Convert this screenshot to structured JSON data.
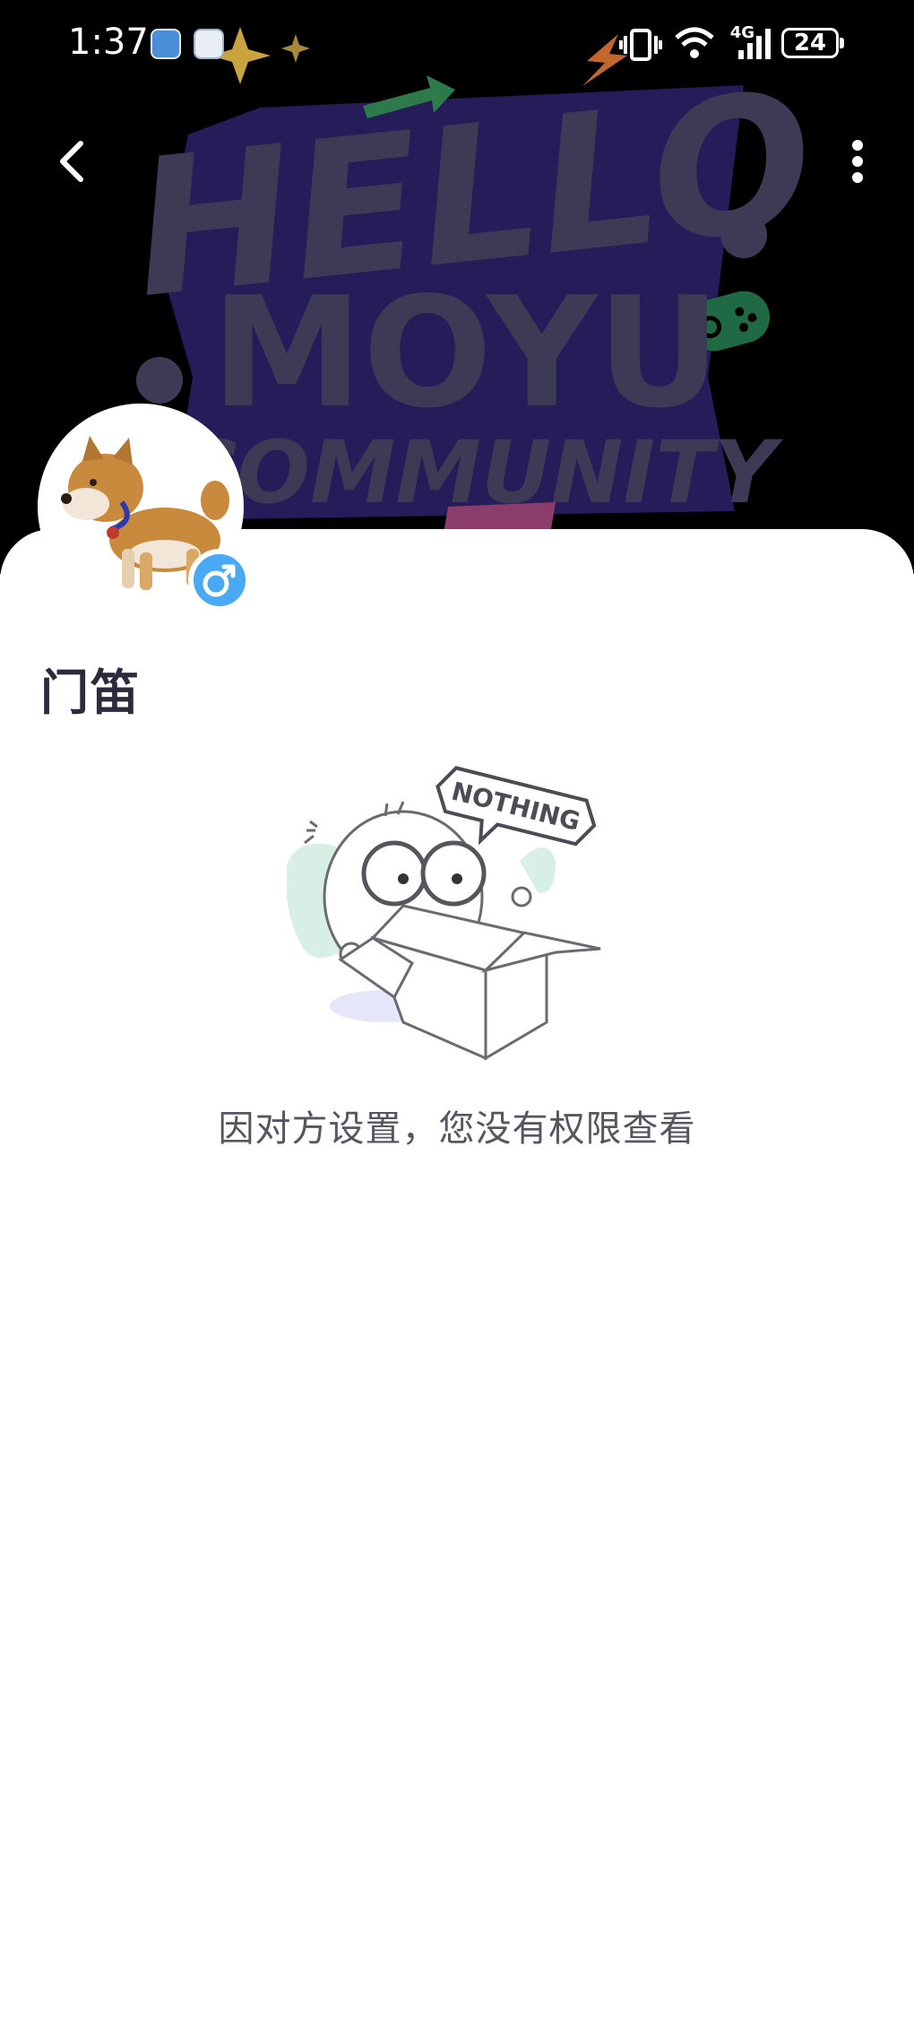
{
  "status_bar": {
    "time": "1:37",
    "battery": "24",
    "network": "4G"
  },
  "banner": {
    "line1": "HELLO",
    "line2": "MOYU",
    "line3": "COMMUNITY"
  },
  "profile": {
    "username": "门笛",
    "gender": "male"
  },
  "empty_state": {
    "bubble_text": "NOTHING",
    "message": "因对方设置，您没有权限查看"
  },
  "colors": {
    "banner_bg": "#000000",
    "banner_text": "#3d3a55",
    "gender_badge": "#4aa9f5",
    "username": "#2a2b3d",
    "message": "#55565f"
  },
  "icons": {
    "back": "chevron-left-icon",
    "more": "more-vertical-icon",
    "gender": "male-icon"
  }
}
